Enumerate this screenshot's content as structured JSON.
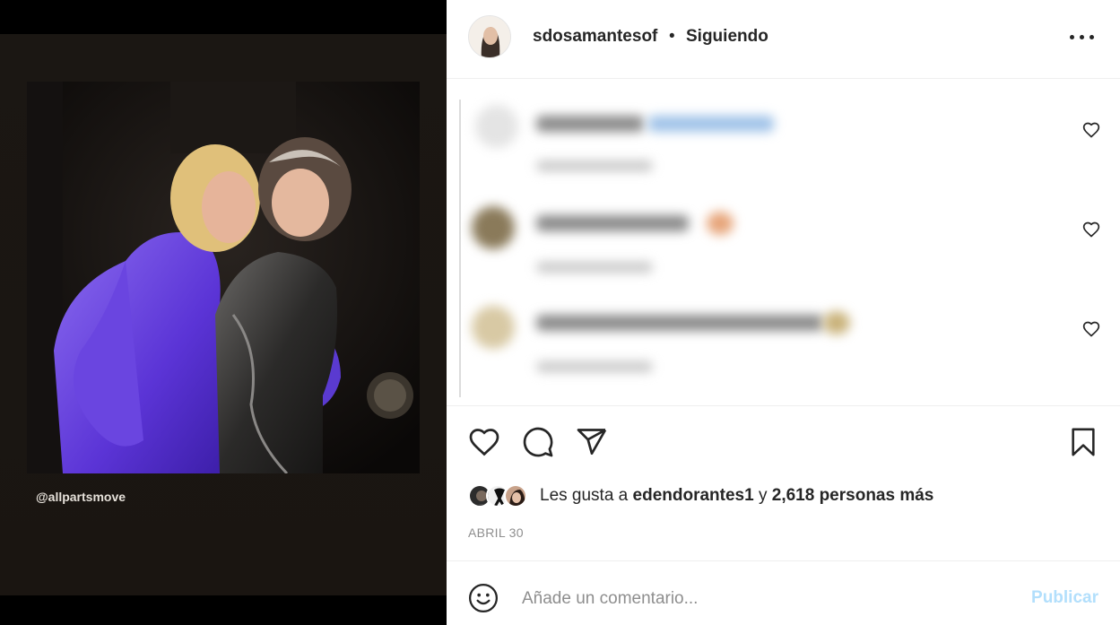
{
  "post": {
    "username": "sdosamantesof",
    "separator": "•",
    "follow_status": "Siguiendo",
    "media_credit": "@allpartsmove",
    "date": "ABRIL 30"
  },
  "likes": {
    "prefix": "Les gusta a ",
    "user": "edendorantes1",
    "middle": " y ",
    "count": "2,618 personas",
    "suffix": " más"
  },
  "add_comment": {
    "placeholder": "Añade un comentario...",
    "publish_label": "Publicar"
  },
  "icons": {
    "more": "more-options-icon",
    "like": "heart-icon",
    "comment": "comment-icon",
    "share": "share-icon",
    "save": "bookmark-icon",
    "emoji": "emoji-icon"
  },
  "colors": {
    "text": "#262626",
    "secondary": "#8e8e8e",
    "publish_disabled": "#b2dffc",
    "border": "#efefef"
  }
}
